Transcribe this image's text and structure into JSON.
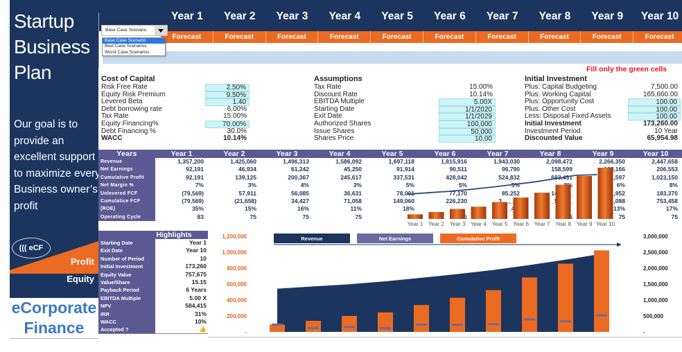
{
  "sidebar": {
    "title_lines": [
      "Startup",
      "Business",
      "Plan"
    ],
    "goal_text": "Our goal is to provide an excellent support to maximize every Business owner’s profit",
    "logo_text": "((( eCF",
    "logo_profit": "Profit",
    "logo_equity": "Equity",
    "brand_lines": [
      "eCorporate",
      "Finance"
    ]
  },
  "header": {
    "years": [
      "Year 1",
      "Year 2",
      "Year 3",
      "Year 4",
      "Year 5",
      "Year 6",
      "Year 7",
      "Year 8",
      "Year 9",
      "Year 10"
    ],
    "forecast_labels": [
      "Forecast",
      "Forecast",
      "Forecast",
      "Forecast",
      "Forecast",
      "Forecast",
      "Forecast",
      "Forecast",
      "Forecast",
      "Forecast"
    ]
  },
  "scenario": {
    "selected": "Base Case Scenario",
    "options": [
      "Base Case Scenario",
      "Best Case Scenarios",
      "Worst Case Scenarios"
    ]
  },
  "fill_note": "Fill only the green cells",
  "cost_of_capital": {
    "title": "Cost of Capital",
    "rows": [
      {
        "label": "Risk Free Rate",
        "value": "2.50%",
        "input": true
      },
      {
        "label": "Equity Risk Premium",
        "value": "9.50%",
        "input": true
      },
      {
        "label": "Levered Beta",
        "value": "1.40",
        "input": true
      },
      {
        "label": "Debt borrowing rate",
        "value": "6.00%",
        "input": false
      },
      {
        "label": "Tax Rate",
        "value": "15.00%",
        "input": false
      },
      {
        "label": "Equity Financing%",
        "value": "70.00%",
        "input": true
      },
      {
        "label": "Debt Financing %",
        "value": "30.0%",
        "input": false
      },
      {
        "label": "WACC",
        "value": "10.14%",
        "input": false,
        "bold": true
      }
    ]
  },
  "assumptions": {
    "title": "Assumptions",
    "rows": [
      {
        "label": "Tax Rate",
        "value": "15.00%",
        "input": false
      },
      {
        "label": "Discount Rate",
        "value": "10.14%",
        "input": false
      },
      {
        "label": "EBITDA Multiple",
        "value": "5.00X",
        "input": true
      },
      {
        "label": "Starting Date",
        "value": "1/1/2020",
        "input": true
      },
      {
        "label": "Exit Date",
        "value": "1/1/2029",
        "input": true
      },
      {
        "label": "Authorized Shares",
        "value": "100,000",
        "input": true
      },
      {
        "label": "Issue Shares",
        "value": "50,000",
        "input": true
      },
      {
        "label": "Shares Price",
        "value": "10.00",
        "input": true
      }
    ]
  },
  "initial_investment": {
    "title": "Initial Investment",
    "rows": [
      {
        "label": "Plus: Capital Budgeting",
        "value": "7,500.00",
        "input": false
      },
      {
        "label": "Plus: Working Capital",
        "value": "165,660.00",
        "input": false
      },
      {
        "label": "Plus: Opportunity Cost",
        "value": "100.00",
        "input": true
      },
      {
        "label": "Plus: Other Cost",
        "value": "100.00",
        "input": true
      },
      {
        "label": "Less: Disposal Fixed Assets",
        "value": "100.00",
        "input": true
      },
      {
        "label": "Initial Investment",
        "value": "173,260.00",
        "input": false,
        "bold": true
      },
      {
        "label": "Investment Period",
        "value": "10  Year",
        "input": false
      },
      {
        "label": "Discounted Value",
        "value": "65,954.98",
        "input": false,
        "bold": true
      }
    ]
  },
  "years_table": {
    "header_label": "Years",
    "columns": [
      "Year 1",
      "Year 2",
      "Year 3",
      "Year 4",
      "Year 5",
      "Year 6",
      "Year 7",
      "Year 8",
      "Year 9",
      "Year 10"
    ],
    "rows": [
      {
        "label": "Revenue",
        "values": [
          "1,357,200",
          "1,425,060",
          "1,496,313",
          "1,586,092",
          "1,697,118",
          "1,815,916",
          "1,943,030",
          "2,098,472",
          "2,266,350",
          "2,447,658"
        ]
      },
      {
        "label": "Net Earnings",
        "values": [
          "92,191",
          "46,934",
          "61,242",
          "45,250",
          "91,914",
          "90,511",
          "96,790",
          "158,599",
          "133,166",
          "206,553"
        ]
      },
      {
        "label": "Cumulative Profit",
        "values": [
          "92,191",
          "139,125",
          "200,367",
          "245,617",
          "337,531",
          "428,042",
          "524,832",
          "683,431",
          "8__,597",
          "1,023,150"
        ]
      },
      {
        "label": "Net Margin %",
        "values": [
          "7%",
          "3%",
          "4%",
          "3%",
          "5%",
          "5%",
          "5%",
          "8%",
          "6%",
          "8%"
        ]
      },
      {
        "label": "Unlevered FCF",
        "values": [
          "(79,569)",
          "57,911",
          "56,085",
          "36,631",
          "78,001",
          "77,170",
          "85,252",
          "142,___",
          "___,952",
          "183,370"
        ]
      },
      {
        "label": "Cumulatice FCF",
        "values": [
          "(79,569)",
          "(21,658)",
          "34,427",
          "71,058",
          "149,060",
          "226,230",
          "3__,__2",
          "_54,___",
          "5__,088",
          "753,458"
        ]
      },
      {
        "label": "(ROE)",
        "values": [
          "35%",
          "15%",
          "16%",
          "11%",
          "18%",
          "",
          "_4%",
          "",
          "13%",
          "17%"
        ]
      },
      {
        "label": "Operating Cycle",
        "values": [
          "83",
          "75",
          "75",
          "75",
          "75",
          "75",
          "75",
          "75",
          "75",
          "75"
        ]
      }
    ]
  },
  "highlights": {
    "title": "Highlights",
    "rows": [
      {
        "label": "Starting Date",
        "value": "Year 1"
      },
      {
        "label": "Exit Date",
        "value": "Year 10"
      },
      {
        "label": "Number of Period",
        "value": "10"
      },
      {
        "label": "Initial Investment",
        "value": "173,260"
      },
      {
        "label": "Equity Value",
        "value": "757,675"
      },
      {
        "label": "Value/Share",
        "value": "15.15"
      },
      {
        "label": "Payback Period",
        "value": "6  Years"
      },
      {
        "label": "EBITDA Multiple",
        "value": "5.00 X"
      },
      {
        "label": "NPV",
        "value": "584,415"
      },
      {
        "label": "IRR",
        "value": "31%"
      },
      {
        "label": "WACC",
        "value": "10%"
      },
      {
        "label": "Accepted ?",
        "value": "👍",
        "icon": "thumbs-up-icon"
      }
    ]
  },
  "chart_data": [
    {
      "type": "bar",
      "title": "",
      "categories": [
        "Year 1",
        "Year 2",
        "Year 3",
        "Year 4",
        "Year 5",
        "Year 6",
        "Year 7",
        "Year 8",
        "Year 9",
        "Year 10"
      ],
      "series": [
        {
          "name": "Cumulative Profit",
          "type": "bar",
          "values": [
            92191,
            139125,
            200367,
            245617,
            337531,
            428042,
            524832,
            683431,
            856597,
            1023150
          ]
        },
        {
          "name": "Revenue",
          "type": "line",
          "values": [
            1357200,
            1425060,
            1496313,
            1586092,
            1697118,
            1815916,
            1943030,
            2098472,
            2266350,
            2447658
          ]
        }
      ],
      "legend": "none"
    },
    {
      "type": "bar",
      "title": "",
      "categories": [
        "Year 1",
        "Year 2",
        "Year 3",
        "Year 4",
        "Year 5",
        "Year 6",
        "Year 7",
        "Year 8",
        "Year 9",
        "Year 10"
      ],
      "series": [
        {
          "name": "Revenue",
          "type": "area",
          "axis": "left",
          "values": [
            1357200,
            1425060,
            1496313,
            1586092,
            1697118,
            1815916,
            1943030,
            2098472,
            2266350,
            2447658
          ]
        },
        {
          "name": "Net Earnings",
          "type": "marker",
          "axis": "left",
          "values": [
            92191,
            46934,
            61242,
            45250,
            91914,
            90511,
            96790,
            158599,
            133166,
            206553
          ]
        },
        {
          "name": "Cumulative Profit",
          "type": "bar",
          "axis": "right",
          "values": [
            92191,
            139125,
            200367,
            245617,
            337531,
            428042,
            524832,
            683431,
            856597,
            1023150
          ]
        }
      ],
      "left_axis": {
        "ticks": [
          "-",
          "200,000",
          "400,000",
          "600,000",
          "800,000",
          "1,000,000",
          "1,200,000"
        ],
        "range": [
          0,
          1200000
        ]
      },
      "right_axis": {
        "ticks": [
          "-",
          "500,000",
          "1,000,000",
          "1,500,000",
          "2,000,000",
          "2,500,000",
          "3,000,000"
        ],
        "range": [
          0,
          3000000
        ]
      },
      "legend_labels": [
        "Revenue",
        "Net Earnings",
        "Cumulative Profit"
      ],
      "legend": "top",
      "colors": {
        "revenue": "#1b355e",
        "net_earnings": "#6b6a9e",
        "cumulative_profit": "#ec6b22"
      }
    }
  ]
}
